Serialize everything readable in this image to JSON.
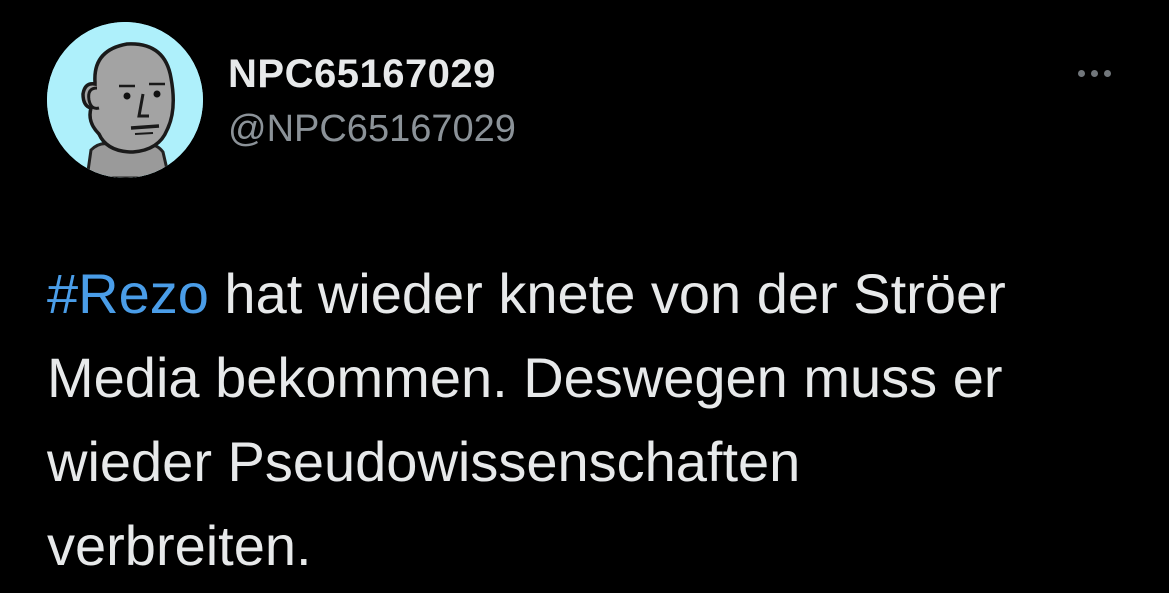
{
  "user": {
    "display_name": "NPC65167029",
    "handle": "@NPC65167029",
    "avatar_icon": "npc-face-avatar"
  },
  "menu": {
    "more_icon": "more-dots-icon"
  },
  "tweet": {
    "hashtag": "#Rezo",
    "line1_rest": " hat wieder knete von der Ströer",
    "line2": "Media bekommen. Deswegen muss er",
    "line3": "wieder Pseudowissenschaften",
    "line4": "verbreiten."
  },
  "colors": {
    "background": "#000000",
    "text": "#e7e9ea",
    "secondary": "#8b9298",
    "link": "#4a9de8",
    "avatar_bg": "#aef0fb"
  }
}
